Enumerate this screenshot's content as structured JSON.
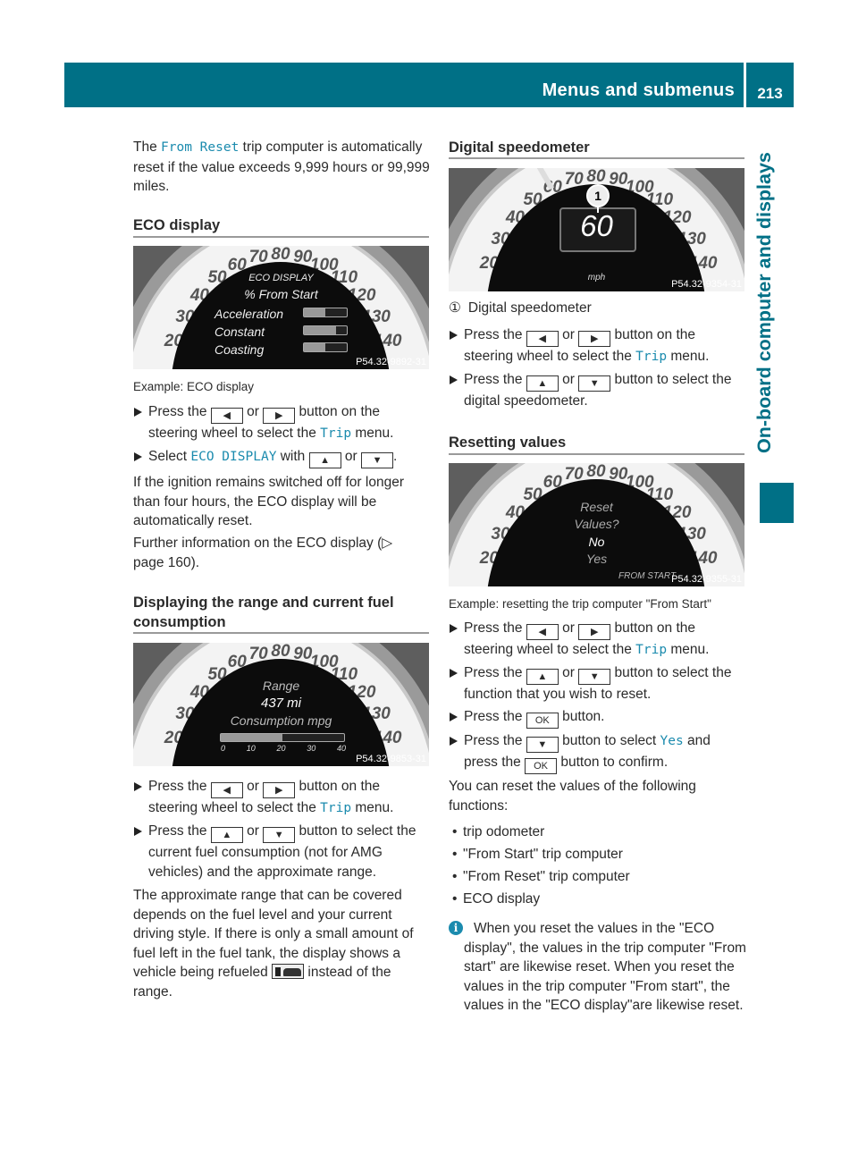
{
  "header": {
    "title": "Menus and submenus",
    "page_number": "213"
  },
  "side_tab": "On-board computer and displays",
  "left": {
    "intro": {
      "pre": "The ",
      "code": "From Reset",
      "post": " trip computer is automatically reset if the value exceeds 9,999 hours or 99,999 miles."
    },
    "eco_heading": "ECO display",
    "eco_image": {
      "title": "ECO DISPLAY",
      "subtitle": "% From Start",
      "rows": [
        {
          "label": "Acceleration",
          "fill": 0.5
        },
        {
          "label": "Constant",
          "fill": 0.75
        },
        {
          "label": "Coasting",
          "fill": 0.5
        }
      ],
      "code": "P54.32-9892-31"
    },
    "eco_caption": "Example: ECO display",
    "eco_step1": {
      "a": "Press the ",
      "k1": "◀",
      "b": " or ",
      "k2": "▶",
      "c": " button on the steering wheel to select the ",
      "code": "Trip",
      "d": " menu."
    },
    "eco_step2": {
      "a": "Select ",
      "code": "ECO DISPLAY",
      "b": " with ",
      "k1": "▲",
      "c": " or ",
      "k2": "▼",
      "d": "."
    },
    "eco_para1": "If the ignition remains switched off for longer than four hours, the ECO display will be automatically reset.",
    "eco_para2": "Further information on the ECO display (▷ page 160).",
    "range_heading": "Displaying the range and current fuel consumption",
    "range_image": {
      "label": "Range",
      "value": "437 mi",
      "consumption": "Consumption mpg",
      "fill": 0.5,
      "ticks": [
        "0",
        "10",
        "20",
        "30",
        "40"
      ],
      "code": "P54.32-9853-31"
    },
    "range_step1": {
      "a": "Press the ",
      "k1": "◀",
      "b": " or ",
      "k2": "▶",
      "c": " button on the steering wheel to select the ",
      "code": "Trip",
      "d": " menu."
    },
    "range_step2": {
      "a": "Press the ",
      "k1": "▲",
      "b": " or ",
      "k2": "▼",
      "c": " button to select the current fuel consumption (not for AMG vehicles) and the approximate range."
    },
    "range_para": {
      "a": "The approximate range that can be covered depends on the fuel level and your current driving style. If there is only a small amount of fuel left in the fuel tank, the display shows a vehicle being refueled ",
      "icon": "refuel-icon",
      "b": " instead of the range."
    }
  },
  "right": {
    "speedo_heading": "Digital speedometer",
    "speedo_image": {
      "callout": "1",
      "speed": "60",
      "unit": "mph",
      "code": "P54.32-9354-31"
    },
    "speedo_legend": {
      "num": "①",
      "text": "Digital speedometer"
    },
    "speedo_step1": {
      "a": "Press the ",
      "k1": "◀",
      "b": " or ",
      "k2": "▶",
      "c": " button on the steering wheel to select the ",
      "code": "Trip",
      "d": " menu."
    },
    "speedo_step2": {
      "a": "Press the ",
      "k1": "▲",
      "b": " or ",
      "k2": "▼",
      "c": " button to select the digital speedometer."
    },
    "reset_heading": "Resetting values",
    "reset_image": {
      "l1": "Reset",
      "l2": "Values?",
      "no": "No",
      "yes": "Yes",
      "mode": "FROM START",
      "code": "P54.32-9355-31"
    },
    "reset_caption": "Example: resetting the trip computer \"From Start\"",
    "reset_step1": {
      "a": "Press the ",
      "k1": "◀",
      "b": " or ",
      "k2": "▶",
      "c": " button on the steering wheel to select the ",
      "code": "Trip",
      "d": " menu."
    },
    "reset_step2": {
      "a": "Press the ",
      "k1": "▲",
      "b": " or ",
      "k2": "▼",
      "c": " button to select the function that you wish to reset."
    },
    "reset_step3": {
      "a": "Press the ",
      "k1": "OK",
      "b": " button."
    },
    "reset_step4": {
      "a": "Press the ",
      "k1": "▼",
      "b": " button to select ",
      "code": "Yes",
      "c": " and press the ",
      "k2": "OK",
      "d": " button to confirm."
    },
    "reset_para": "You can reset the values of the following functions:",
    "reset_list": [
      "trip odometer",
      "\"From Start\" trip computer",
      "\"From Reset\" trip computer",
      "ECO display"
    ],
    "info_note": "When you reset the values in the \"ECO display\", the values in the trip computer \"From start\" are likewise reset. When you reset the values in the trip computer \"From start\", the values in the \"ECO display\"are likewise reset."
  },
  "gauge_scale": [
    "20",
    "30",
    "40",
    "50",
    "60",
    "70",
    "80",
    "90",
    "100",
    "110",
    "120",
    "130",
    "140"
  ]
}
